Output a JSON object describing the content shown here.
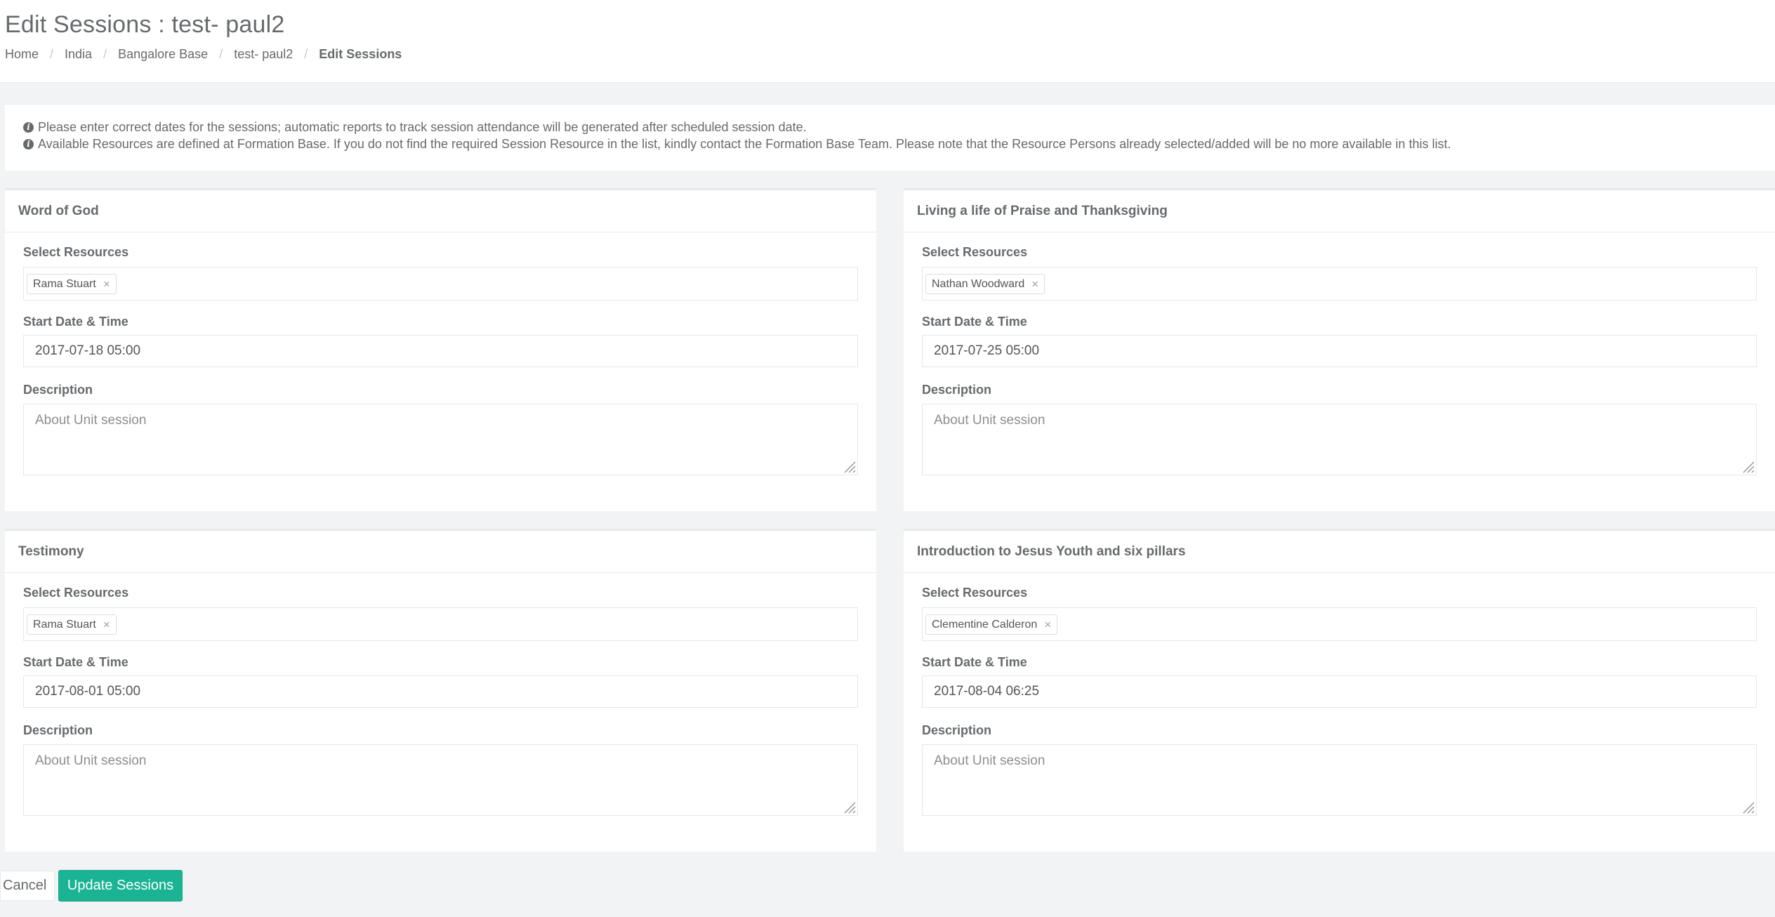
{
  "page": {
    "title": "Edit Sessions : test- paul2",
    "breadcrumb": [
      "Home",
      "India",
      "Bangalore Base",
      "test- paul2",
      "Edit Sessions"
    ]
  },
  "info": {
    "line1": "Please enter correct dates for the sessions; automatic reports to track session attendance will be generated after scheduled session date.",
    "line2": "Available Resources are defined at Formation Base. If you do not find the required Session Resource in the list, kindly contact the Formation Base Team. Please note that the Resource Persons already selected/added will be no more available in this list."
  },
  "labels": {
    "resources": "Select Resources",
    "start": "Start Date & Time",
    "description": "Description",
    "description_placeholder": "About Unit session",
    "remove_symbol": "×"
  },
  "sessions": [
    {
      "title": "Word of God",
      "resource": "Rama Stuart",
      "start": "2017-07-18 05:00"
    },
    {
      "title": "Living a life of Praise and Thanksgiving",
      "resource": "Nathan Woodward",
      "start": "2017-07-25 05:00"
    },
    {
      "title": "Testimony",
      "resource": "Rama Stuart",
      "start": "2017-08-01 05:00"
    },
    {
      "title": "Introduction to Jesus Youth and six pillars",
      "resource": "Clementine Calderon",
      "start": "2017-08-04 06:25"
    }
  ],
  "buttons": {
    "cancel": "Cancel",
    "update": "Update Sessions"
  },
  "colors": {
    "primary": "#1ab394",
    "background": "#f2f3f5",
    "text": "#676a6c"
  },
  "icons": {
    "info": "info-circle-icon",
    "remove": "close-icon",
    "resize": "resize-grip-icon"
  }
}
